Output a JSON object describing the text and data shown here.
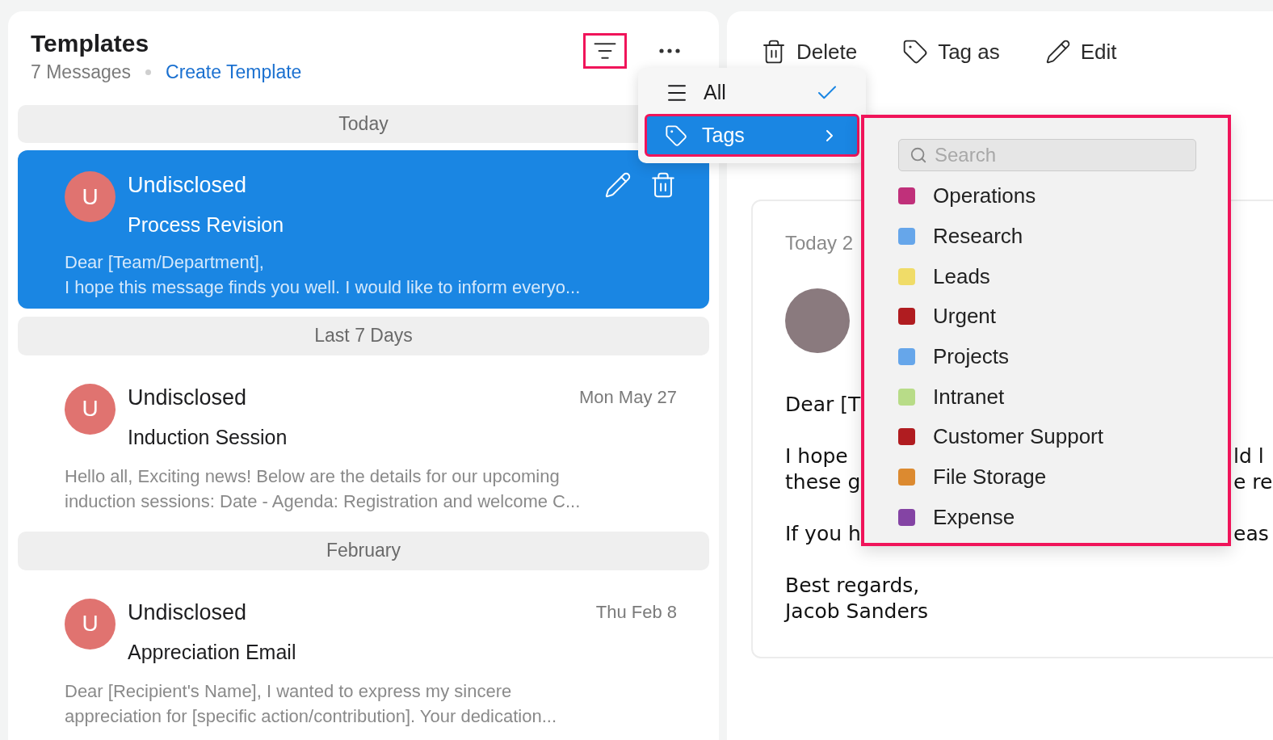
{
  "list_panel": {
    "title": "Templates",
    "count": "7 Messages",
    "create_link": "Create Template",
    "filter_button": {
      "highlighted": true
    },
    "groups": [
      {
        "label": "Today",
        "items": [
          {
            "avatar": "U",
            "sender": "Undisclosed",
            "subject": "Process Revision",
            "preview": [
              "Dear [Team/Department],",
              "I hope this message finds you well. I would like to inform everyo..."
            ],
            "selected": true
          }
        ]
      },
      {
        "label": "Last 7 Days",
        "items": [
          {
            "avatar": "U",
            "sender": "Undisclosed",
            "subject": "Induction Session",
            "date": "Mon May 27",
            "preview": [
              "Hello all, Exciting news! Below are the details for our upcoming",
              "induction sessions: Date - Agenda: Registration and welcome C..."
            ],
            "selected": false
          }
        ]
      },
      {
        "label": "February",
        "items": [
          {
            "avatar": "U",
            "sender": "Undisclosed",
            "subject": "Appreciation Email",
            "date": "Thu Feb 8",
            "preview": [
              "Dear [Recipient's Name], I wanted to express my sincere",
              "appreciation for [specific action/contribution]. Your dedication..."
            ],
            "selected": false
          }
        ]
      }
    ]
  },
  "toolbar": {
    "actions": [
      {
        "kind": "delete",
        "label": "Delete"
      },
      {
        "kind": "tag",
        "label": "Tag as"
      },
      {
        "kind": "edit",
        "label": "Edit"
      }
    ]
  },
  "reading_pane": {
    "date": "Today 2",
    "paragraphs": [
      [
        {
          "left": "Dear [T"
        }
      ],
      [
        {
          "left": "I hope",
          "right": "ld l"
        },
        {
          "left": "these g",
          "right": "e re"
        }
      ],
      [
        {
          "left": "If you h",
          "right": "eas"
        }
      ],
      [
        {
          "left": "Best regards,"
        },
        {
          "left": "Jacob Sanders"
        }
      ]
    ]
  },
  "filter_menu": {
    "items": [
      {
        "kind": "all",
        "label": "All",
        "checked": true,
        "selected": false,
        "highlighted": false
      },
      {
        "kind": "tags",
        "label": "Tags",
        "checked": false,
        "selected": true,
        "highlighted": true
      }
    ]
  },
  "tags_submenu": {
    "highlighted": true,
    "search": {
      "placeholder": "Search"
    },
    "tags": [
      {
        "label": "Operations",
        "color": "#c0307a"
      },
      {
        "label": "Research",
        "color": "#66a6ea"
      },
      {
        "label": "Leads",
        "color": "#f0dc68"
      },
      {
        "label": "Urgent",
        "color": "#b01c20"
      },
      {
        "label": "Projects",
        "color": "#66a6ea"
      },
      {
        "label": "Intranet",
        "color": "#b8dc88"
      },
      {
        "label": "Customer Support",
        "color": "#b01c20"
      },
      {
        "label": "File Storage",
        "color": "#dc8a30"
      },
      {
        "label": "Expense",
        "color": "#8444a4"
      }
    ]
  }
}
